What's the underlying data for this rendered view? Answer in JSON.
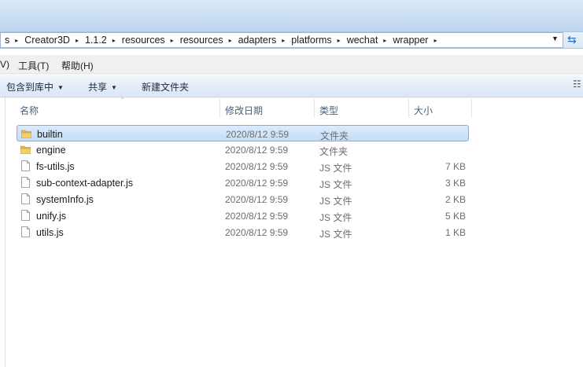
{
  "address": {
    "crumbs": [
      "s",
      "Creator3D",
      "1.1.2",
      "resources",
      "resources",
      "adapters",
      "platforms",
      "wechat",
      "wrapper"
    ],
    "separator": "▸",
    "dropdown_icon": "▼",
    "refresh_icon": "⇆"
  },
  "menubar": {
    "prev_partial": "V)",
    "tools": "工具(T)",
    "help": "帮助(H)"
  },
  "toolbar": {
    "include_library": "包含到库中",
    "share": "共享",
    "new_folder": "新建文件夹",
    "caret": "▼",
    "view_icon": "☷"
  },
  "columns": {
    "name": "名称",
    "modified": "修改日期",
    "type": "类型",
    "size": "大小",
    "sort_indicator": "^"
  },
  "files": [
    {
      "name": "builtin",
      "date": "2020/8/12 9:59",
      "type": "文件夹",
      "size": "",
      "icon": "folder-icon",
      "selected": true
    },
    {
      "name": "engine",
      "date": "2020/8/12 9:59",
      "type": "文件夹",
      "size": "",
      "icon": "folder-icon",
      "selected": false
    },
    {
      "name": "fs-utils.js",
      "date": "2020/8/12 9:59",
      "type": "JS 文件",
      "size": "7 KB",
      "icon": "file-icon",
      "selected": false
    },
    {
      "name": "sub-context-adapter.js",
      "date": "2020/8/12 9:59",
      "type": "JS 文件",
      "size": "3 KB",
      "icon": "file-icon",
      "selected": false
    },
    {
      "name": "systemInfo.js",
      "date": "2020/8/12 9:59",
      "type": "JS 文件",
      "size": "2 KB",
      "icon": "file-icon",
      "selected": false
    },
    {
      "name": "unify.js",
      "date": "2020/8/12 9:59",
      "type": "JS 文件",
      "size": "5 KB",
      "icon": "file-icon",
      "selected": false
    },
    {
      "name": "utils.js",
      "date": "2020/8/12 9:59",
      "type": "JS 文件",
      "size": "1 KB",
      "icon": "file-icon",
      "selected": false
    }
  ],
  "colors": {
    "selection": "#cde3fb",
    "folder": "#e8b94a",
    "header_text": "#4c607a"
  }
}
